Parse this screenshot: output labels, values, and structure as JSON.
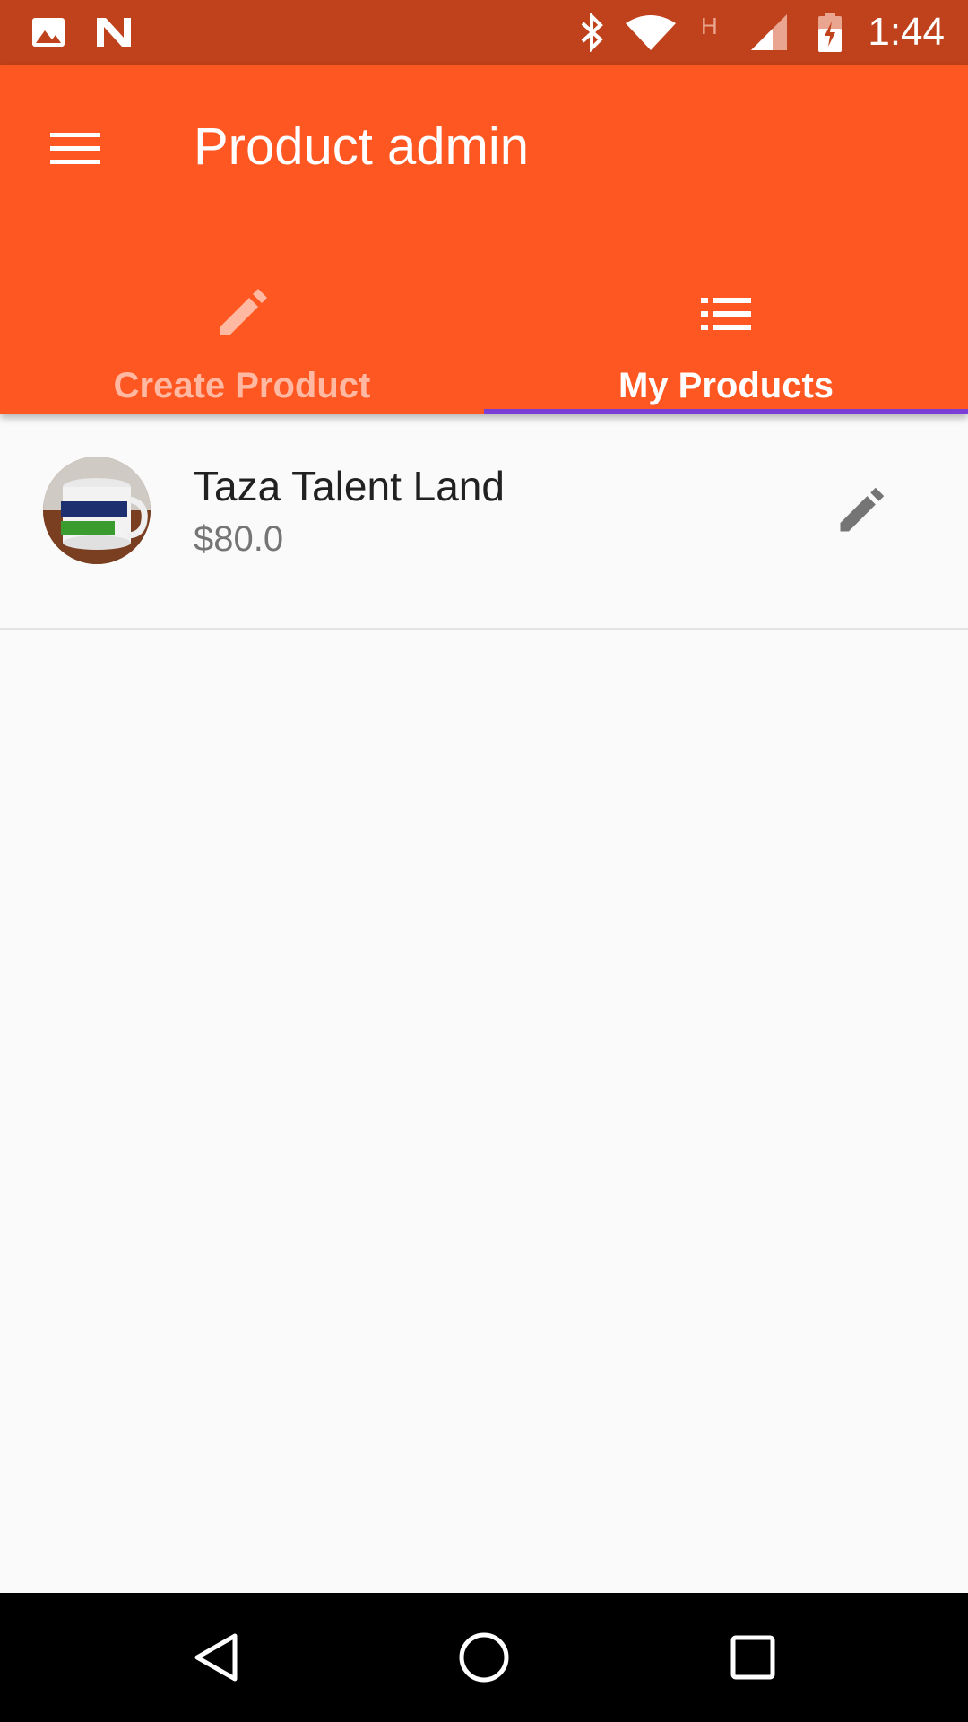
{
  "status_bar": {
    "time": "1:44",
    "icons": [
      "gallery-icon",
      "n-icon",
      "bluetooth-icon",
      "wifi-icon",
      "h-signal-icon",
      "cell-signal-icon",
      "battery-charging-icon"
    ]
  },
  "app_bar": {
    "title": "Product admin",
    "menu_icon": "menu-icon",
    "color": "#ff5722"
  },
  "tabs": [
    {
      "label": "Create Product",
      "icon": "pencil-icon",
      "selected": false
    },
    {
      "label": "My Products",
      "icon": "list-icon",
      "selected": true
    }
  ],
  "tab_indicator_color": "#7b3fd6",
  "products": [
    {
      "title": "Taza Talent Land",
      "price": "$80.0",
      "avatar": "mug-photo",
      "action_icon": "edit-icon"
    }
  ],
  "nav_bar": {
    "icons": [
      "back-icon",
      "home-icon",
      "recents-icon"
    ]
  }
}
